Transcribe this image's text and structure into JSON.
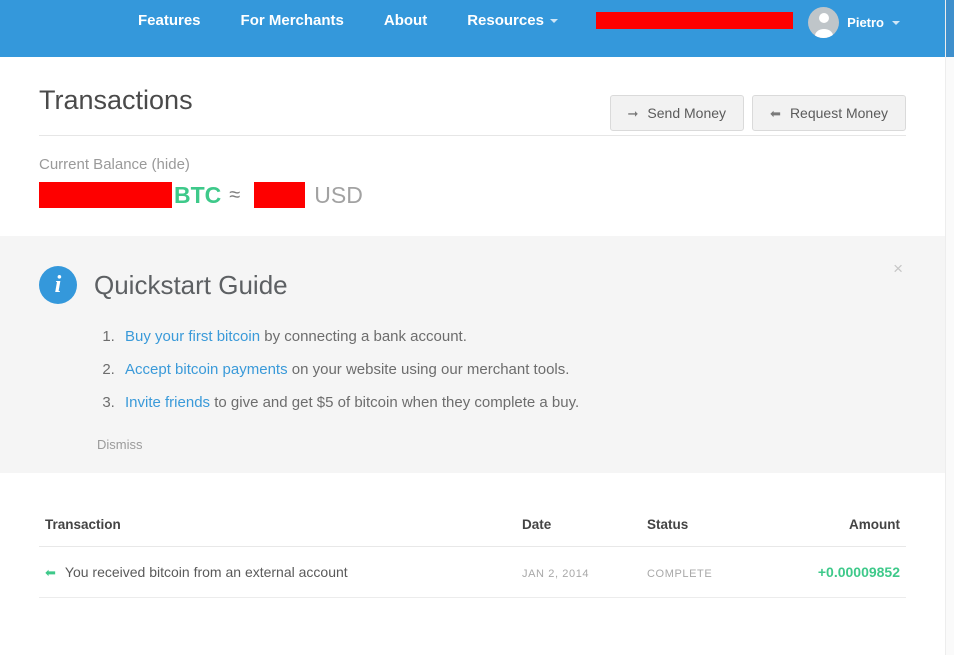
{
  "nav": {
    "items": [
      {
        "label": "Features",
        "caret": false
      },
      {
        "label": "For Merchants",
        "caret": false
      },
      {
        "label": "About",
        "caret": false
      },
      {
        "label": "Resources",
        "caret": true
      }
    ],
    "redacted_field": "",
    "user": {
      "name": "Pietro",
      "avatar_icon": "user-avatar-icon",
      "caret_icon": "chevron-down-icon"
    }
  },
  "header": {
    "title": "Transactions",
    "send_money": {
      "label": "Send Money",
      "icon": "arrow-right-icon"
    },
    "request_money": {
      "label": "Request Money",
      "icon": "arrow-left-icon"
    }
  },
  "balance": {
    "label": "Current Balance (hide)",
    "btc_value": "",
    "btc_unit": "BTC",
    "approx_symbol": "≈",
    "usd_value": "",
    "usd_unit": "USD",
    "btc_color": "#3ec98a"
  },
  "quickstart": {
    "icon": "info-icon",
    "title": "Quickstart Guide",
    "close_icon": "×",
    "steps": [
      {
        "link": "Buy your first bitcoin",
        "text": " by connecting a bank account."
      },
      {
        "link": "Accept bitcoin payments",
        "text": " on your website using our merchant tools."
      },
      {
        "link": "Invite friends",
        "text": " to give and get $5 of bitcoin when they complete a buy."
      }
    ],
    "dismiss_label": "Dismiss",
    "link_color": "#3a9ad9"
  },
  "transactions": {
    "columns": {
      "transaction": "Transaction",
      "date": "Date",
      "status": "Status",
      "amount": "Amount"
    },
    "rows": [
      {
        "icon": "arrow-left-icon",
        "description": "You received bitcoin from an external account",
        "date": "JAN 2, 2014",
        "status": "COMPLETE",
        "amount": "+0.00009852",
        "amount_color": "#3ec98a"
      }
    ]
  },
  "colors": {
    "nav_blue": "#3498db",
    "panel_gray": "#f5f5f5",
    "redaction": "#fe0000"
  }
}
